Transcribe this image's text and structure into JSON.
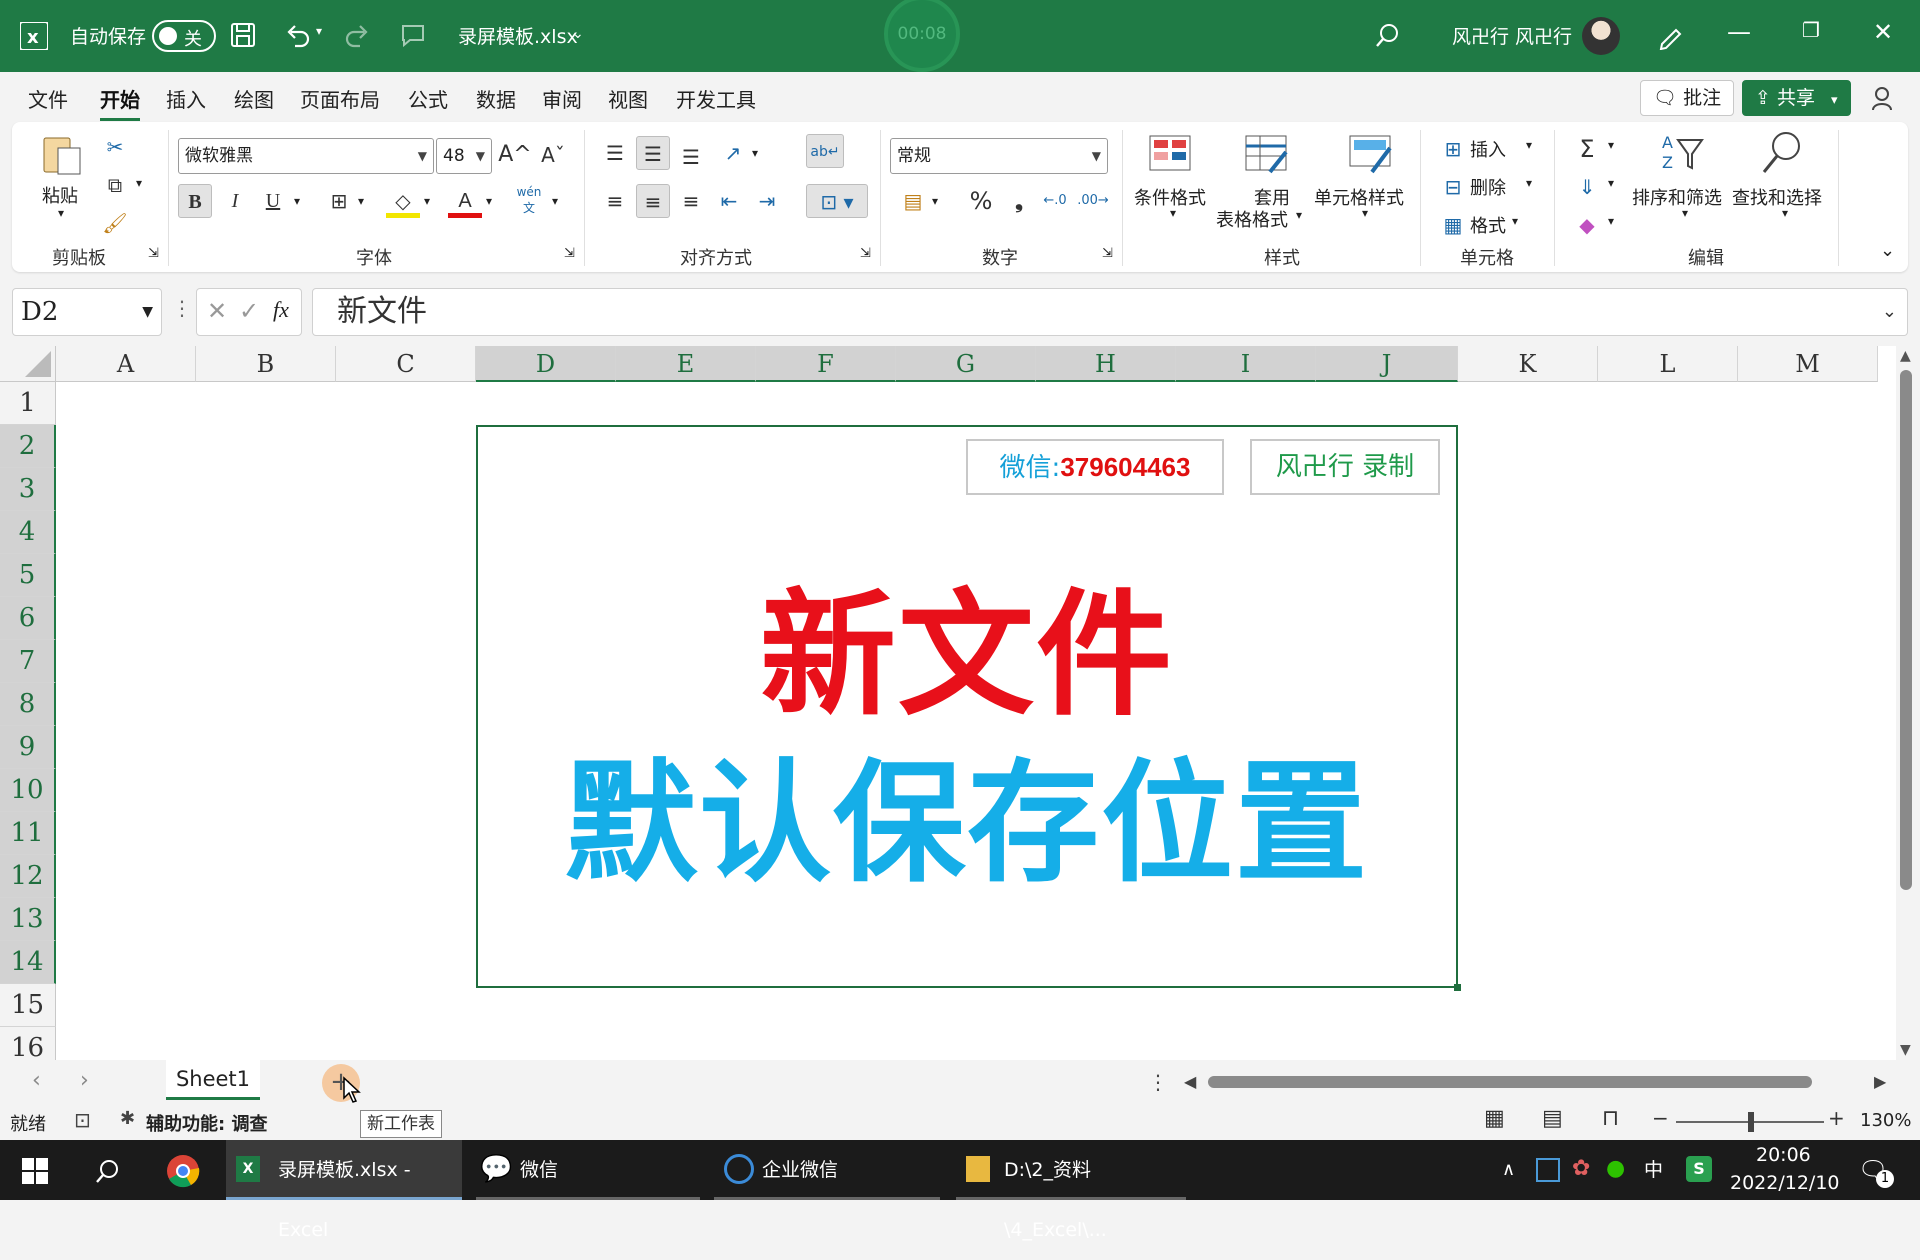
{
  "titlebar": {
    "autosave_label": "自动保存",
    "autosave_state": "关",
    "file_name": "录屏模板.xlsx",
    "timer": "00:08",
    "user_name": "风卍行 风卍行"
  },
  "ribbon_tabs": [
    "文件",
    "开始",
    "插入",
    "绘图",
    "页面布局",
    "公式",
    "数据",
    "审阅",
    "视图",
    "开发工具"
  ],
  "top_buttons": {
    "comment": "批注",
    "share": "共享"
  },
  "ribbon": {
    "clipboard": {
      "paste": "粘贴",
      "group": "剪贴板"
    },
    "font": {
      "name": "微软雅黑",
      "size": "48",
      "group": "字体",
      "bold": "B",
      "italic": "I",
      "underline": "U",
      "phonetic": "wén"
    },
    "alignment": {
      "group": "对齐方式"
    },
    "number": {
      "format": "常规",
      "group": "数字",
      "percent": "%"
    },
    "styles": {
      "conditional": "条件格式",
      "table_format_1": "套用",
      "table_format_2": "表格格式",
      "cell_styles": "单元格样式",
      "group": "样式"
    },
    "cells": {
      "insert": "插入",
      "delete": "删除",
      "format": "格式",
      "group": "单元格"
    },
    "editing": {
      "sort_filter": "排序和筛选",
      "find_select": "查找和选择",
      "group": "编辑"
    }
  },
  "formula_bar": {
    "name_box": "D2",
    "fx": "fx",
    "content": "新文件"
  },
  "columns": [
    "A",
    "B",
    "C",
    "D",
    "E",
    "F",
    "G",
    "H",
    "I",
    "J",
    "K",
    "L",
    "M"
  ],
  "rows": [
    "1",
    "2",
    "3",
    "4",
    "5",
    "6",
    "7",
    "8",
    "9",
    "10",
    "11",
    "12",
    "13",
    "14",
    "15",
    "16"
  ],
  "cell_content": {
    "wechat_label": "微信:",
    "wechat_id": "379604463",
    "author": "风卍行 录制",
    "title_line1": "新文件",
    "title_line2": "默认保存位置"
  },
  "sheets": {
    "active": "Sheet1",
    "new_sheet_tooltip": "新工作表"
  },
  "status": {
    "ready": "就绪",
    "accessibility": "辅助功能: 调查",
    "zoom": "130%"
  },
  "taskbar": {
    "excel": "录屏模板.xlsx - Excel",
    "wechat": "微信",
    "work_wechat": "企业微信",
    "explorer": "D:\\2_资料\\4_Excel\\...",
    "ime": "中",
    "time": "20:06",
    "date": "2022/12/10",
    "notif": "1"
  },
  "colors": {
    "excel_green": "#1f7a45",
    "red_title": "#e8101a",
    "blue_title": "#15aee8"
  }
}
